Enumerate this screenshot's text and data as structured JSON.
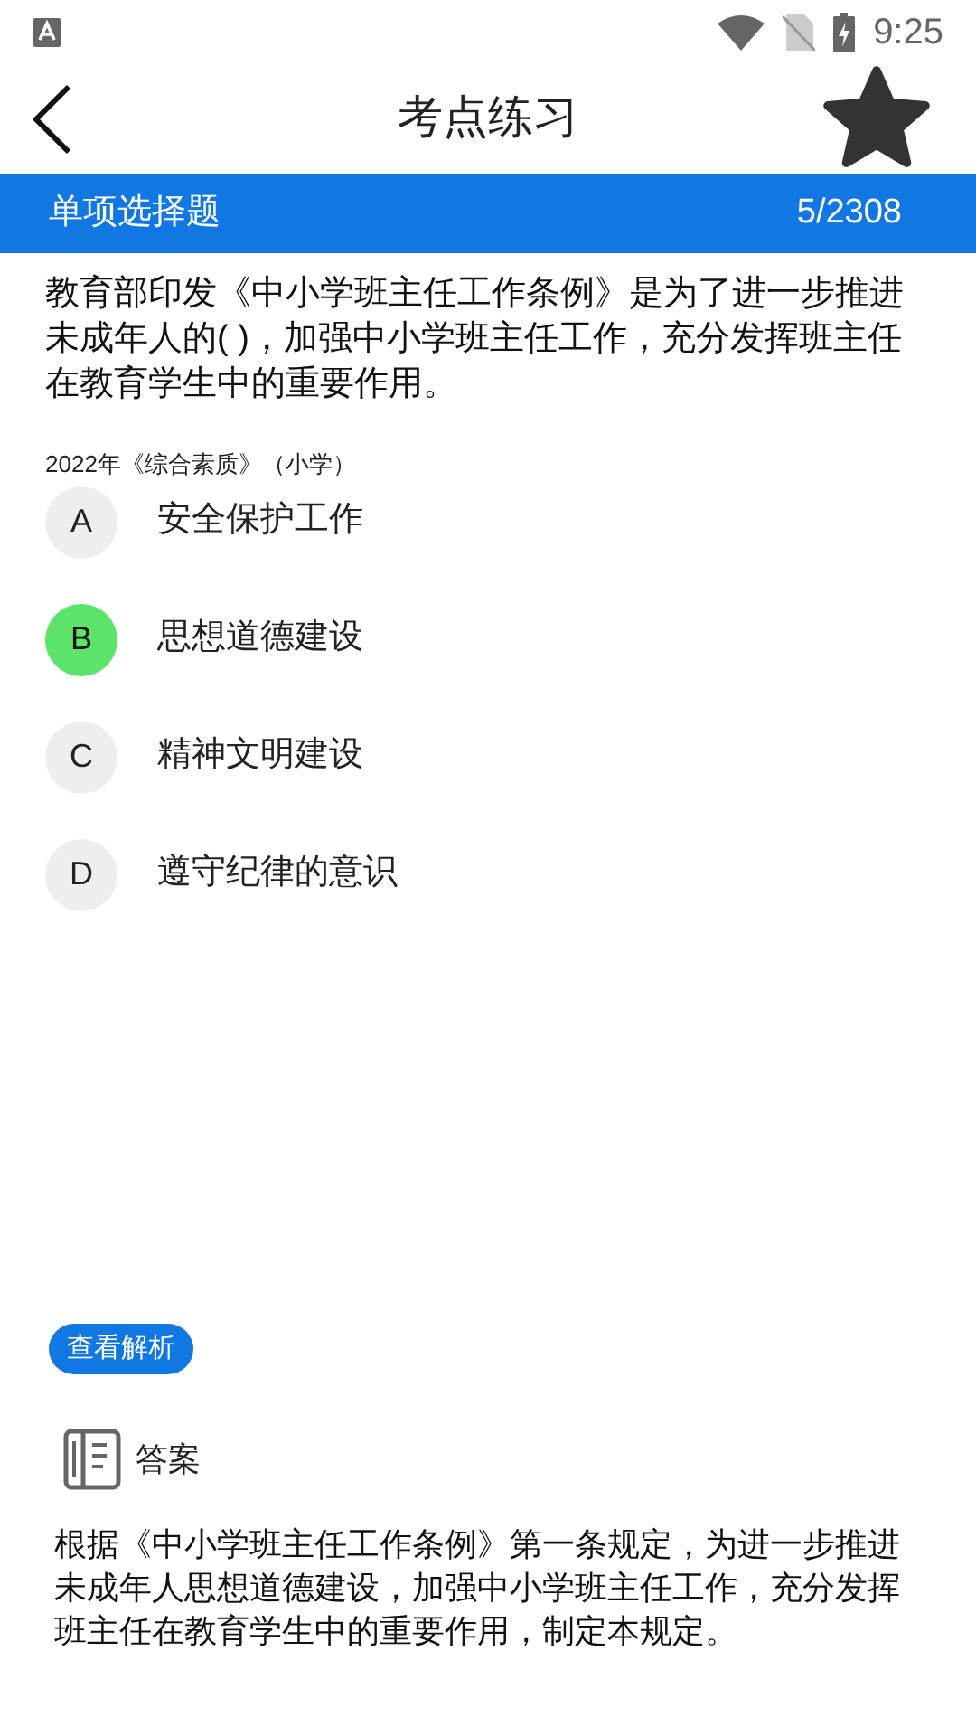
{
  "status_bar": {
    "time": "9:25"
  },
  "header": {
    "title": "考点练习",
    "favorited": true
  },
  "question_bar": {
    "type": "单项选择题",
    "progress": "5/2308"
  },
  "question": {
    "text": "教育部印发《中小学班主任工作条例》是为了进一步推进未成年人的(    )，加强中小学班主任工作，充分发挥班主任在教育学生中的重要作用。",
    "source": "2022年《综合素质》（小学）"
  },
  "options": [
    {
      "letter": "A",
      "text": "安全保护工作",
      "selected": false
    },
    {
      "letter": "B",
      "text": "思想道德建设",
      "selected": true
    },
    {
      "letter": "C",
      "text": "精神文明建设",
      "selected": false
    },
    {
      "letter": "D",
      "text": "遵守纪律的意识",
      "selected": false
    }
  ],
  "analysis_button": "查看解析",
  "answer": {
    "heading": "答案",
    "text": "根据《中小学班主任工作条例》第一条规定，为进一步推进未成年人思想道德建设，加强中小学班主任工作，充分发挥班主任在教育学生中的重要作用，制定本规定。"
  }
}
